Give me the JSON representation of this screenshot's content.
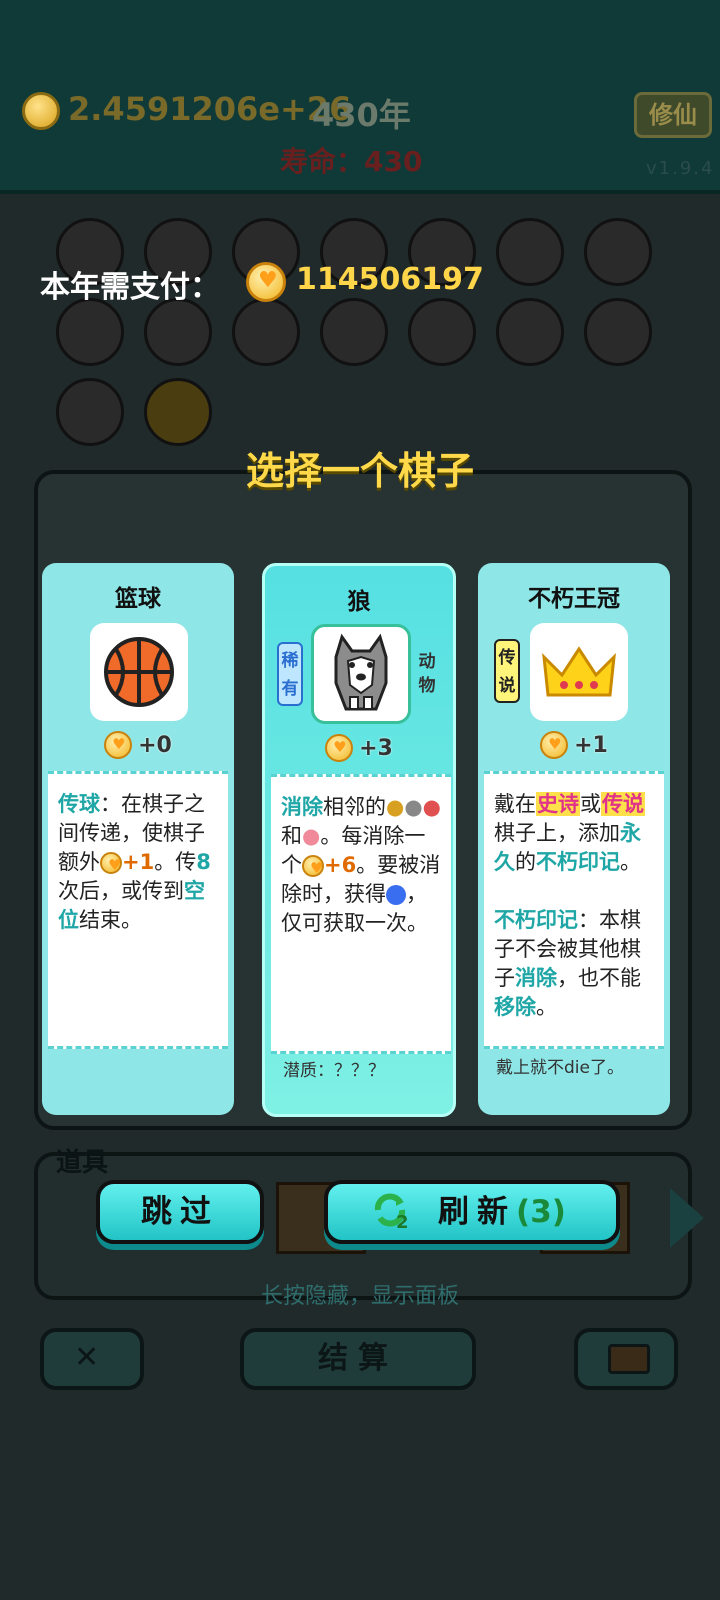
{
  "header": {
    "coins": "2.4591206e+26",
    "year": "430年",
    "xiuxian_label": "修仙",
    "lifespan": "寿命：430",
    "version": "v1.9.4"
  },
  "payment": {
    "label": "本年需支付：",
    "amount": "114506197"
  },
  "choose_title": "选择一个棋子",
  "cards": [
    {
      "title": "篮球",
      "icon": "basketball-icon",
      "value": "+0",
      "desc": {
        "kw1": "传球",
        "t1": "：在棋子之间传递，使棋子额外",
        "bonus": "+1",
        "t2": "。传",
        "num": "8",
        "t3": "次后，或传到",
        "kw2": "空位",
        "t4": "结束。"
      },
      "footer": ""
    },
    {
      "title": "狼",
      "icon": "wolf-icon",
      "rarity": "稀有",
      "category": "动物",
      "value": "+3",
      "desc": {
        "kw1": "消除",
        "t1": "相邻的",
        "t2": "和",
        "t3": "。每消除一个",
        "bonus": "+6",
        "t4": "。要被消除时，获得",
        "t5": "，仅可获取一次。"
      },
      "footer": "潜质：？？？"
    },
    {
      "title": "不朽王冠",
      "icon": "crown-icon",
      "rarity": "传说",
      "value": "+1",
      "desc": {
        "t1": "戴在",
        "kw1": "史诗",
        "t2": "或",
        "kw2": "传说",
        "t3": "棋子上，添加",
        "kw3": "永久",
        "t4": "的",
        "kw4": "不朽印记",
        "t5": "。",
        "kw5": "不朽印记",
        "t6": "：本棋子不会被其他棋子",
        "kw6": "消除",
        "t7": "，也不能",
        "kw7": "移除",
        "t8": "。"
      },
      "footer": "戴上就不die了。"
    }
  ],
  "tools_label": "道具",
  "buttons": {
    "skip": "跳过",
    "refresh": "刷新",
    "refresh_count": "(3)",
    "refresh_icon_badge": "2",
    "settle": "结算"
  },
  "hint": "长按隐藏，显示面板",
  "colors": {
    "accent": "#22c4c6",
    "title_yellow": "#ffd94a",
    "coin": "#f2b51f"
  }
}
